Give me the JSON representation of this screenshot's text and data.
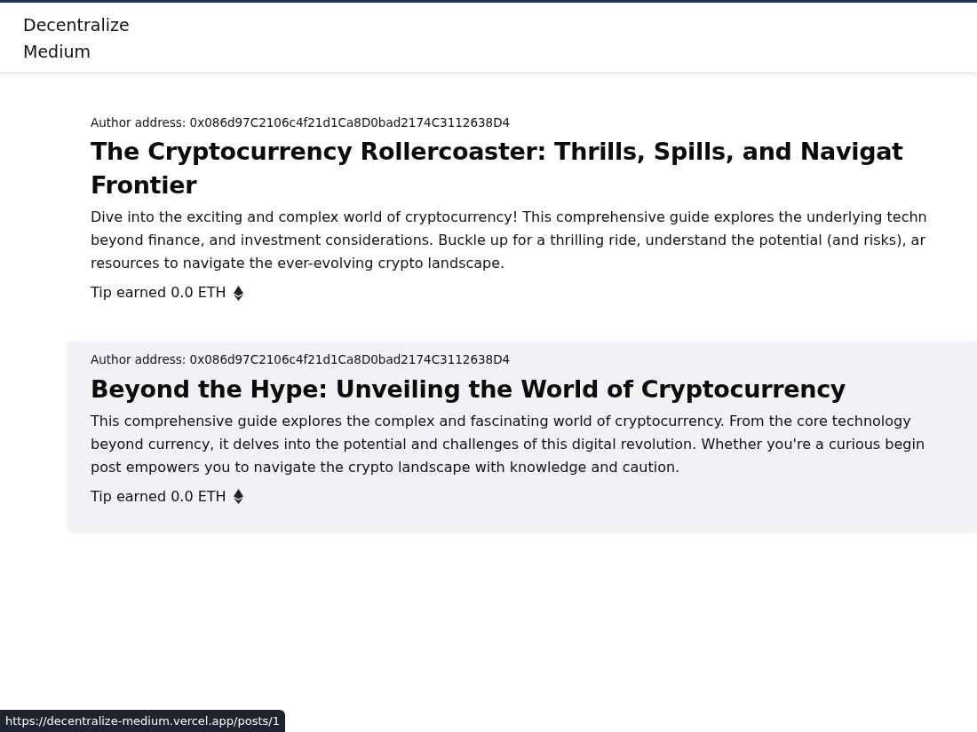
{
  "navbar": {
    "brand_lines": [
      "Decentralize",
      "Medium"
    ]
  },
  "posts": [
    {
      "author_label": "Author address: 0x086d97C2106c4f21d1Ca8D0bad2174C3112638D4",
      "title_lines": [
        "The Cryptocurrency Rollercoaster: Thrills, Spills, and Navigat",
        "Frontier"
      ],
      "description_lines": [
        "Dive into the exciting and complex world of cryptocurrency! This comprehensive guide explores the underlying techn",
        "beyond finance, and investment considerations. Buckle up for a thrilling ride, understand the potential (and risks), ar",
        "resources to navigate the ever-evolving crypto landscape."
      ],
      "tip": "Tip earned 0.0 ETH",
      "highlighted": false
    },
    {
      "author_label": "Author address: 0x086d97C2106c4f21d1Ca8D0bad2174C3112638D4",
      "title_lines": [
        "Beyond the Hype: Unveiling the World of Cryptocurrency"
      ],
      "description_lines": [
        "This comprehensive guide explores the complex and fascinating world of cryptocurrency. From the core technology",
        "beyond currency, it delves into the potential and challenges of this digital revolution. Whether you're a curious begin",
        "post empowers you to navigate the crypto landscape with knowledge and caution."
      ],
      "tip": "Tip earned 0.0 ETH",
      "highlighted": true
    }
  ],
  "status_bar": {
    "url": "https://decentralize-medium.vercel.app/posts/1"
  }
}
